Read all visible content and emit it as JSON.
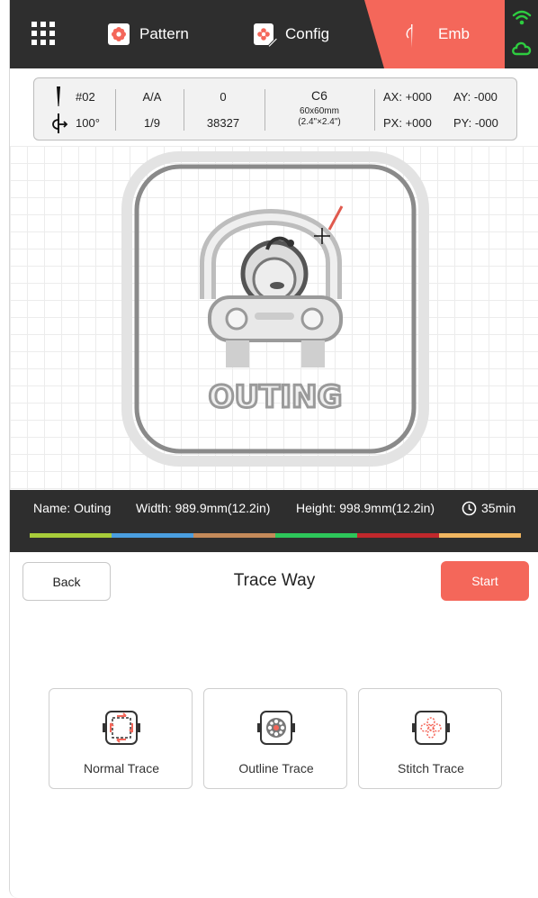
{
  "topbar": {
    "menu_icon": "grid-menu-icon",
    "tabs": [
      {
        "label": "Pattern",
        "icon": "flower-icon"
      },
      {
        "label": "Config",
        "icon": "flower-edit-icon"
      },
      {
        "label": "Emb",
        "icon": "needle-icon",
        "active": true
      }
    ],
    "status_icons": [
      "wifi-icon",
      "cloud-icon"
    ],
    "accent_color": "#f4675a",
    "status_color": "#2ecc40"
  },
  "info": {
    "needle": "#02",
    "angle": "100°",
    "color_seq": "A/A",
    "color_count": "1/9",
    "stitch_current": "0",
    "stitch_total": "38327",
    "hoop_code": "C6",
    "hoop_size": "60x60mm",
    "hoop_size_in": "(2.4\"×2.4\")",
    "ax": "AX: +000",
    "ay": "AY: -000",
    "px": "PX: +000",
    "py": "PY: -000"
  },
  "design": {
    "text": "OUTING"
  },
  "namebar": {
    "name": "Name: Outing",
    "width": "Width: 989.9mm(12.2in)",
    "height": "Height: 998.9mm(12.2in)",
    "time": "35min",
    "thread_colors": [
      "#a8cc3a",
      "#4a9ee0",
      "#c48a5a",
      "#2dc65a",
      "#c0282c",
      "#f0b660"
    ]
  },
  "trace": {
    "back_label": "Back",
    "title": "Trace Way",
    "start_label": "Start",
    "options": [
      {
        "label": "Normal Trace",
        "icon": "normal-trace-icon"
      },
      {
        "label": "Outline Trace",
        "icon": "outline-trace-icon"
      },
      {
        "label": "Stitch Trace",
        "icon": "stitch-trace-icon"
      }
    ]
  }
}
